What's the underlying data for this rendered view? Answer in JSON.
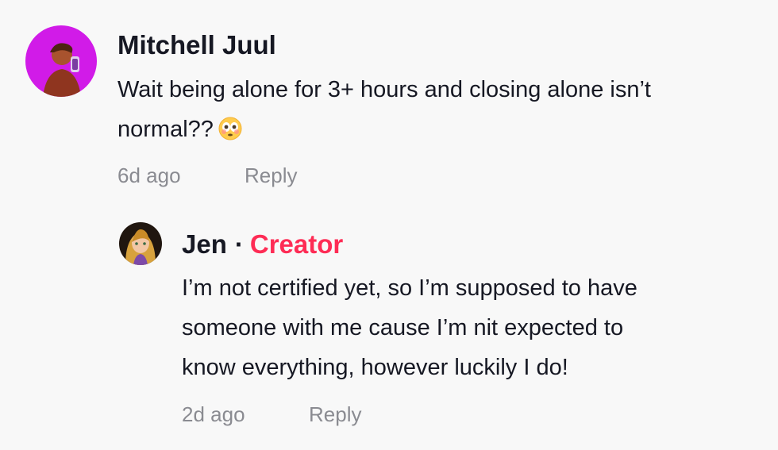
{
  "comments": [
    {
      "username": "Mitchell Juul",
      "text_line_1": "Wait being alone for 3+ hours and closing alone isn’t",
      "text_line_2": "normal??",
      "time": "6d ago",
      "reply_label": "Reply",
      "avatar_bg": "#d11be8"
    },
    {
      "username": "Jen",
      "badge_separator": "·",
      "badge": "Creator",
      "text_line_1": "I’m not certified yet, so I’m supposed to have",
      "text_line_2": "someone with me cause I’m nit expected to",
      "text_line_3": "know everything, however luckily I do!",
      "time": "2d ago",
      "reply_label": "Reply"
    }
  ],
  "icons": {
    "flushed_emoji": "flushed-face-icon"
  },
  "colors": {
    "background": "#f8f8f8",
    "text": "#161823",
    "muted": "#8a8b91",
    "creator": "#fe2c55"
  }
}
